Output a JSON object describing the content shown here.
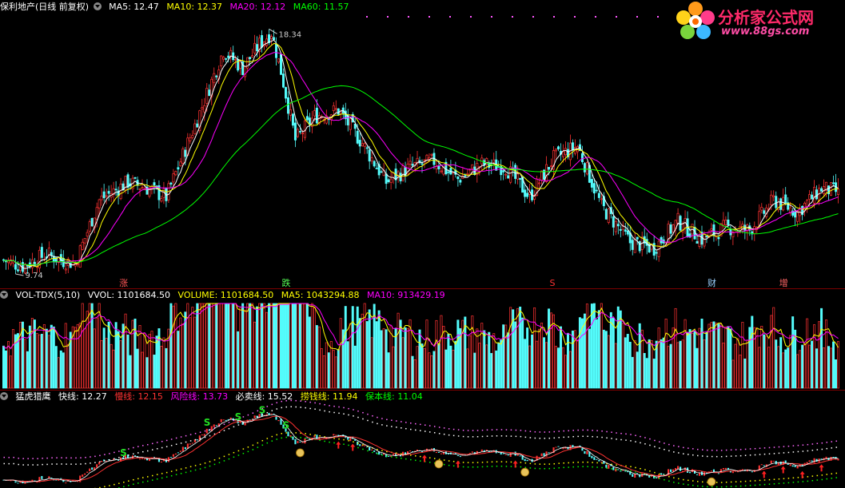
{
  "header_main": {
    "title": "保利地产(日线 前复权)",
    "ma5": "MA5: 12.47",
    "ma10": "MA10: 12.37",
    "ma20": "MA20: 12.12",
    "ma60": "MA60: 11.57"
  },
  "header_vol": {
    "title": "VOL-TDX(5,10)",
    "vvol": "VVOL: 1101684.50",
    "volume": "VOLUME: 1101684.50",
    "ma5": "MA5: 1043294.88",
    "ma10": "MA10: 913429.19"
  },
  "header_ind": {
    "title": "猛虎猎鹰",
    "fast": "快线: 12.27",
    "slow": "慢线: 12.15",
    "risk": "风险线: 13.73",
    "sell": "必卖线: 15.52",
    "gather": "捞钱线: 11.94",
    "keep": "保本线: 11.04"
  },
  "logo": {
    "text": "分析家公式网",
    "url_text": "www.88gs.com"
  },
  "colors": {
    "background": "#000000",
    "up": "#ff3232",
    "down": "#54fcfc",
    "ma5": "#ffffff",
    "ma10": "#ffff00",
    "ma20": "#ff00ff",
    "ma60": "#00ff00",
    "separator": "#7a0000"
  },
  "chart_data": {
    "type": "candlestick",
    "price_range": [
      9.74,
      18.34
    ],
    "high_label": "18.34",
    "low_label": "9.74",
    "ma_values": {
      "MA5": 12.47,
      "MA10": 12.37,
      "MA20": 12.12,
      "MA60": 11.57
    },
    "key_points": [
      {
        "i": 0,
        "p": 10.2
      },
      {
        "i": 8,
        "p": 10.0
      },
      {
        "i": 18,
        "p": 10.4
      },
      {
        "i": 24,
        "p": 10.2
      },
      {
        "i": 30,
        "p": 10.1
      },
      {
        "i": 40,
        "p": 12.2
      },
      {
        "i": 52,
        "p": 12.8
      },
      {
        "i": 60,
        "p": 12.6
      },
      {
        "i": 68,
        "p": 12.3
      },
      {
        "i": 80,
        "p": 14.7
      },
      {
        "i": 92,
        "p": 17.2
      },
      {
        "i": 100,
        "p": 16.6
      },
      {
        "i": 107,
        "p": 17.4
      },
      {
        "i": 112,
        "p": 17.8
      },
      {
        "i": 116,
        "p": 16.5
      },
      {
        "i": 122,
        "p": 14.2
      },
      {
        "i": 130,
        "p": 15.0
      },
      {
        "i": 140,
        "p": 15.2
      },
      {
        "i": 150,
        "p": 14.1
      },
      {
        "i": 160,
        "p": 12.8
      },
      {
        "i": 170,
        "p": 13.3
      },
      {
        "i": 180,
        "p": 13.5
      },
      {
        "i": 190,
        "p": 12.9
      },
      {
        "i": 200,
        "p": 13.4
      },
      {
        "i": 210,
        "p": 13.3
      },
      {
        "i": 220,
        "p": 12.3
      },
      {
        "i": 230,
        "p": 13.6
      },
      {
        "i": 240,
        "p": 14.0
      },
      {
        "i": 250,
        "p": 12.0
      },
      {
        "i": 262,
        "p": 10.8
      },
      {
        "i": 272,
        "p": 10.6
      },
      {
        "i": 282,
        "p": 11.5
      },
      {
        "i": 292,
        "p": 10.9
      },
      {
        "i": 302,
        "p": 11.3
      },
      {
        "i": 312,
        "p": 11.2
      },
      {
        "i": 322,
        "p": 12.2
      },
      {
        "i": 332,
        "p": 11.8
      },
      {
        "i": 342,
        "p": 12.6
      },
      {
        "i": 349,
        "p": 12.47
      }
    ],
    "bottom_labels": [
      {
        "text": "涨",
        "color": "#ff5555",
        "i": 50
      },
      {
        "text": "跌",
        "color": "#55ff55",
        "i": 118
      },
      {
        "text": "S",
        "color": "#ff3333",
        "i": 230
      },
      {
        "text": "财",
        "color": "#9ad0ff",
        "i": 296
      },
      {
        "text": "增",
        "color": "#ff6666",
        "i": 326
      }
    ],
    "volume": {
      "last": 1101684.5,
      "ma5": 1043294.88,
      "ma10": 913429.19
    },
    "indicator": {
      "fast": 12.27,
      "slow": 12.15,
      "risk": 13.73,
      "sell": 15.52,
      "gather": 11.94,
      "keep": 11.04
    },
    "signals": [
      {
        "type": "S",
        "i": 50
      },
      {
        "type": "S",
        "i": 85
      },
      {
        "type": "S",
        "i": 98
      },
      {
        "type": "S",
        "i": 108
      },
      {
        "type": "S",
        "i": 118
      },
      {
        "type": "bag",
        "i": 124
      },
      {
        "type": "bag",
        "i": 182
      },
      {
        "type": "bag",
        "i": 218
      },
      {
        "type": "bag",
        "i": 296
      },
      {
        "type": "arrow",
        "i": 140
      },
      {
        "type": "arrow",
        "i": 146
      },
      {
        "type": "arrow",
        "i": 176
      },
      {
        "type": "arrow",
        "i": 190
      },
      {
        "type": "arrow",
        "i": 214
      },
      {
        "type": "arrow",
        "i": 318
      },
      {
        "type": "arrow",
        "i": 326
      },
      {
        "type": "arrow",
        "i": 334
      },
      {
        "type": "arrow",
        "i": 342
      }
    ]
  }
}
